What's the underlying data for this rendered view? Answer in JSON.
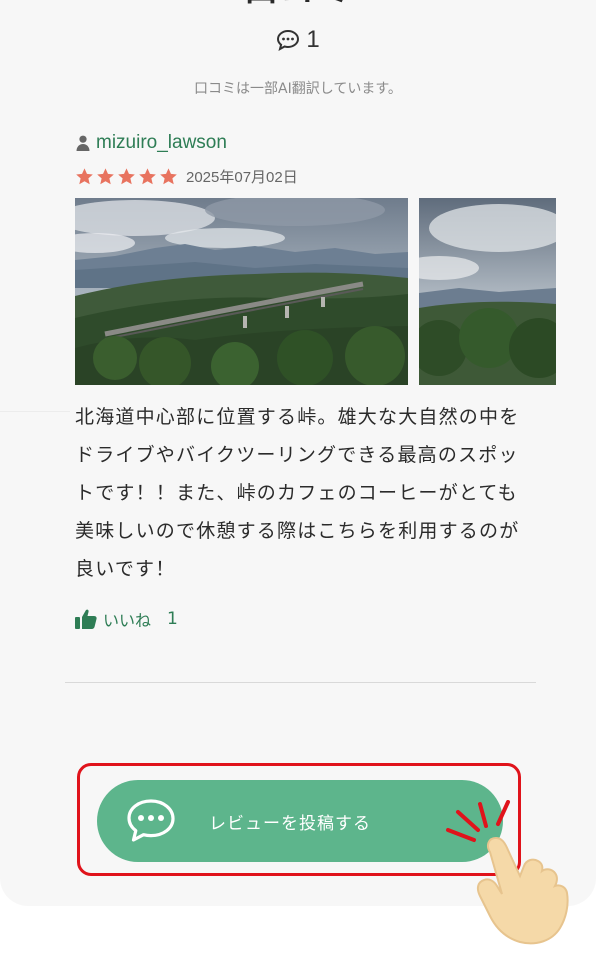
{
  "section": {
    "title": "口コミ",
    "comment_count": "1",
    "translation_note": "口コミは一部AI翻訳しています。"
  },
  "review": {
    "username": "mizuiro_lawson",
    "rating": 5,
    "rating_max": 5,
    "date": "2025年07月02日",
    "text": "北海道中心部に位置する峠。雄大な大自然の中をドライブやバイクツーリングできる最高のスポットです！！また、峠のカフェのコーヒーがとても美味しいので休憩する際はこちらを利用するのが良いです！",
    "like_label": "いいね",
    "like_count": "1"
  },
  "post_button": {
    "label": "レビューを投稿する"
  },
  "colors": {
    "accent_green": "#5db58c",
    "username_green": "#2e7d55",
    "star": "#e8735f",
    "highlight_red": "#e0131b"
  },
  "icons": [
    "comment-icon",
    "user-icon",
    "star-icon",
    "thumbs-up-icon",
    "chat-bubble-icon",
    "pointing-hand-icon"
  ]
}
